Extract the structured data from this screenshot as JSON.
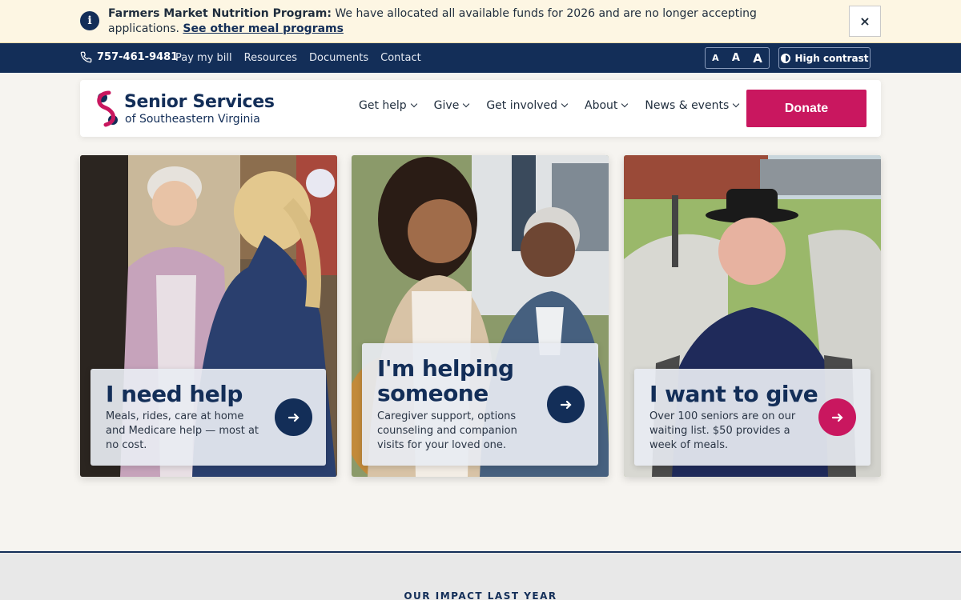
{
  "alert": {
    "title": "Farmers Market Nutrition Program:",
    "message": " We have allocated all available funds for 2026 and are no longer accepting applications. ",
    "link": "See other meal programs",
    "close": "×"
  },
  "utility": {
    "phone": "757-461-9481",
    "links": [
      "Pay my bill",
      "Resources",
      "Documents",
      "Contact"
    ],
    "font_sizes": [
      "A",
      "A",
      "A"
    ],
    "contrast": "High contrast"
  },
  "header": {
    "logo_line1": "Senior Services",
    "logo_line2": "of Southeastern Virginia",
    "nav": [
      "Get help",
      "Give",
      "Get involved",
      "About",
      "News & events"
    ],
    "donate": "Donate"
  },
  "cards": [
    {
      "title": "I need help",
      "desc": "Meals, rides, care at home and Medicare help — most at no cost.",
      "button_color": "#132e58"
    },
    {
      "title": "I'm helping someone",
      "desc": "Caregiver support, options counseling and companion visits for your loved one.",
      "button_color": "#132e58"
    },
    {
      "title": "I want to give",
      "desc": "Over 100 seniors are on our waiting list. $50 provides a week of meals.",
      "button_color": "#c9175f"
    }
  ],
  "impact": {
    "label": "OUR IMPACT LAST YEAR"
  },
  "colors": {
    "navy": "#132e58",
    "accent": "#c9175f",
    "alert_bg": "#fdf6e3"
  }
}
